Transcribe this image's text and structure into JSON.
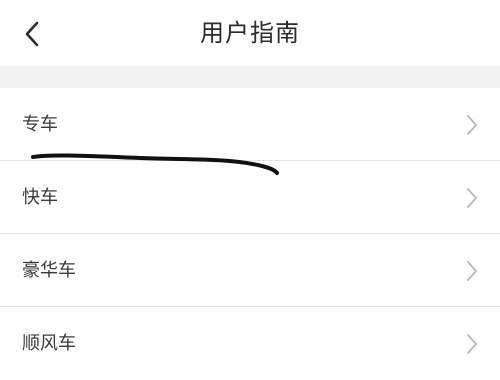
{
  "header": {
    "title": "用户指南",
    "back_icon": "chevron-left-icon"
  },
  "menu": {
    "items": [
      {
        "label": "专车",
        "icon": "chevron-right-icon"
      },
      {
        "label": "快车",
        "icon": "chevron-right-icon"
      },
      {
        "label": "豪华车",
        "icon": "chevron-right-icon"
      },
      {
        "label": "顺风车",
        "icon": "chevron-right-icon"
      }
    ]
  },
  "colors": {
    "background": "#ffffff",
    "gap_band": "#f2f2f2",
    "divider": "#e6e6e6",
    "title_text": "#2b2b2b",
    "item_text": "#3a3a3a",
    "chevron": "#b8b8b8",
    "annotation_stroke": "#111111"
  }
}
